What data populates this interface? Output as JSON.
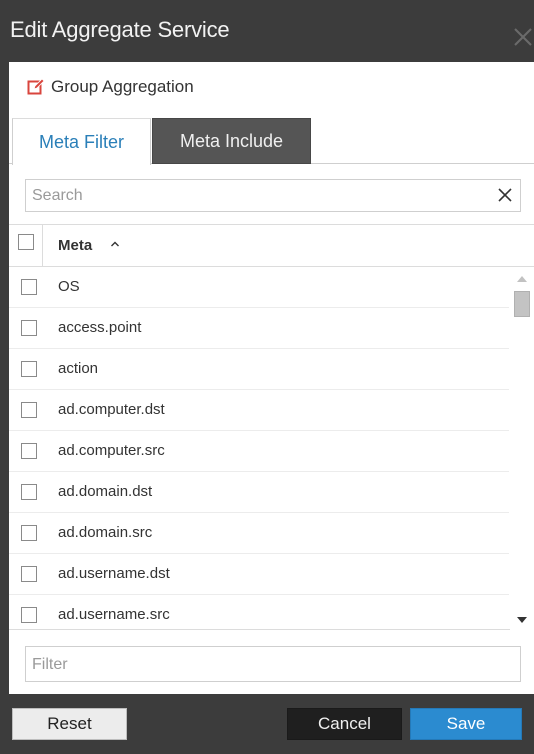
{
  "dialog": {
    "title": "Edit Aggregate Service"
  },
  "group": {
    "label": "Group Aggregation",
    "icon": "edit-icon",
    "icon_color": "#d9453d"
  },
  "tabs": [
    {
      "label": "Meta Filter",
      "active": true
    },
    {
      "label": "Meta Include",
      "active": false
    }
  ],
  "search": {
    "placeholder": "Search",
    "value": ""
  },
  "table": {
    "column": "Meta",
    "sort": "ascending",
    "rows": [
      "OS",
      "access.point",
      "action",
      "ad.computer.dst",
      "ad.computer.src",
      "ad.domain.dst",
      "ad.domain.src",
      "ad.username.dst",
      "ad.username.src"
    ]
  },
  "filter": {
    "placeholder": "Filter",
    "value": ""
  },
  "footer": {
    "reset_label": "Reset",
    "cancel_label": "Cancel",
    "save_label": "Save"
  },
  "colors": {
    "accent": "#2b8bd0",
    "tab_active_text": "#2a7fb8",
    "titlebar": "#3c3c3c"
  }
}
